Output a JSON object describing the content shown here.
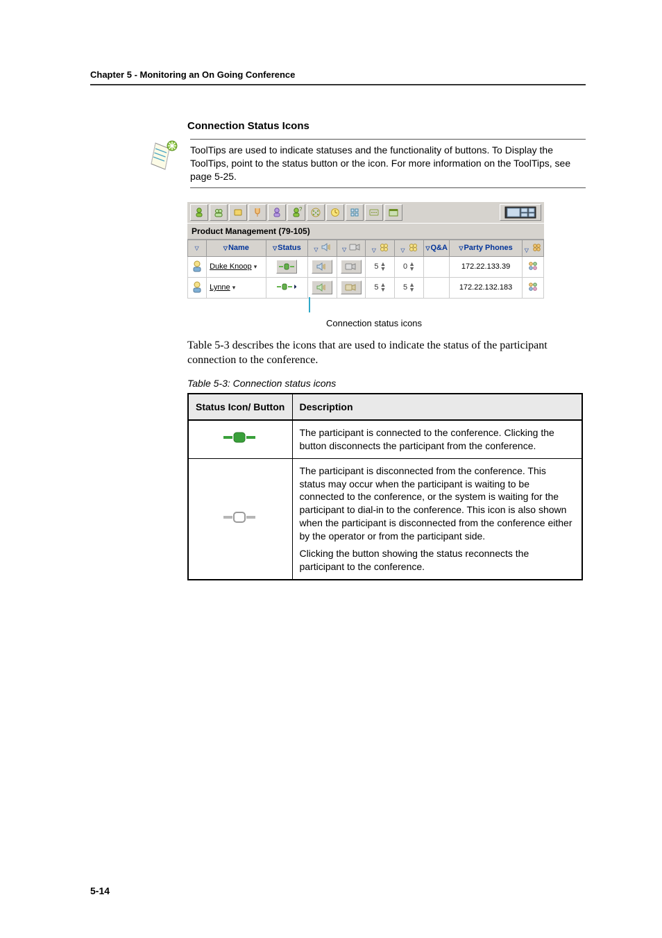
{
  "chapter_header": "Chapter 5 - Monitoring an On Going Conference",
  "section_title": "Connection Status Icons",
  "note_paragraph": "ToolTips are used to indicate statuses and the functionality of buttons. To Display the ToolTips, point to the status button or the icon. For more information on the ToolTips, see page 5-25.",
  "conference_title": "Product Management (79-105)",
  "columns": {
    "name": "Name",
    "status": "Status",
    "qa": "Q&A",
    "party_phones": "Party Phones"
  },
  "rows": [
    {
      "name": "Duke Knoop",
      "spin1": "5",
      "spin2": "0",
      "phone": "172.22.133.39"
    },
    {
      "name": "Lynne",
      "spin1": "5",
      "spin2": "5",
      "phone": "172.22.132.183"
    }
  ],
  "figure_caption": "Connection status icons",
  "body_paragraph": "Table 5-3 describes the icons that are used to indicate the status of the participant connection to the conference.",
  "table_title": "Table 5-3: Connection status icons",
  "desc_table": {
    "head_col1": "Status Icon/ Button",
    "head_col2": "Description",
    "rows": [
      {
        "desc": "The participant is connected to the conference. Clicking the button disconnects the participant from the conference."
      },
      {
        "desc_p1": "The participant is disconnected from the conference. This status may occur when the participant is waiting to be connected to the conference, or the system is waiting for the participant to dial-in to the conference. This icon is also shown when the participant is disconnected from the conference either by the operator or from the participant side.",
        "desc_p2": "Clicking the button showing the status reconnects the participant to the conference."
      }
    ]
  },
  "page_number": "5-14"
}
